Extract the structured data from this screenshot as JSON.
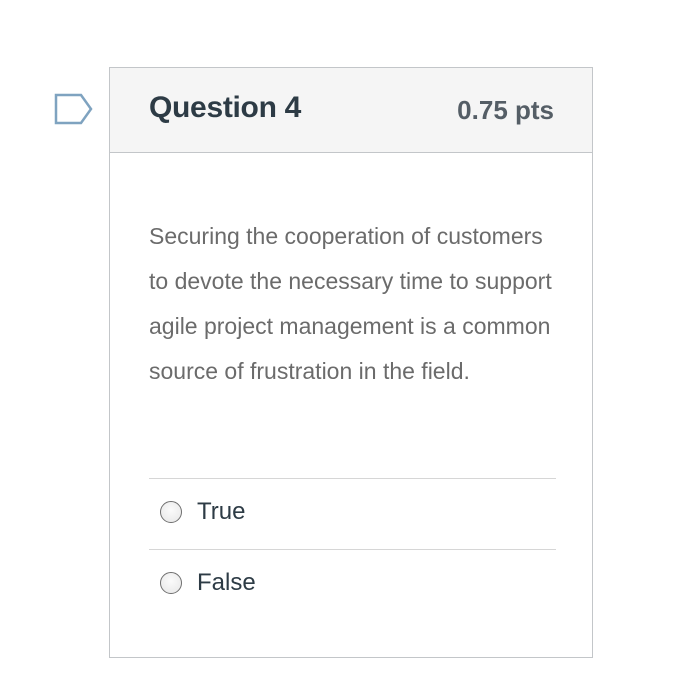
{
  "question": {
    "title": "Question 4",
    "points": "0.75 pts",
    "text": "Securing the cooperation of customers to devote the necessary time to support agile project management is a common source of frustration in the field.",
    "flag_icon": "flag-question-icon"
  },
  "answers": [
    {
      "label": "True",
      "selected": false
    },
    {
      "label": "False",
      "selected": false
    }
  ],
  "colors": {
    "title": "#2d3b45",
    "points": "#555e66",
    "body_text": "#6b6b6b",
    "header_bg": "#f5f5f5",
    "border": "#c3c6c9",
    "flag_stroke": "#7fa3c0"
  }
}
